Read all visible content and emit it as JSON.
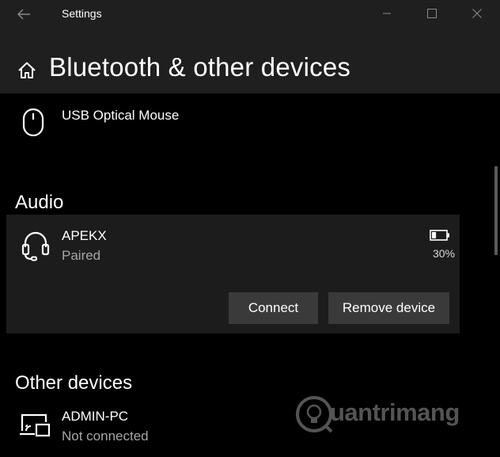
{
  "window": {
    "title": "Settings"
  },
  "header": {
    "page_title": "Bluetooth & other devices"
  },
  "devices": {
    "mouse": {
      "name": "USB Optical Mouse",
      "icon": "mouse-icon"
    }
  },
  "audio": {
    "heading": "Audio",
    "device": {
      "name": "APEKX",
      "status": "Paired",
      "battery": "30%",
      "battery_level": 0.3,
      "icon": "headset-icon"
    },
    "connect_label": "Connect",
    "remove_label": "Remove device"
  },
  "other": {
    "heading": "Other devices",
    "device": {
      "name": "ADMIN-PC",
      "status": "Not connected",
      "icon": "wireless-display-icon"
    }
  },
  "watermark": {
    "text": "uantrimang"
  },
  "colors": {
    "background": "#000000",
    "chrome": "#1f1f1f",
    "card": "#1c1c1c",
    "button": "#3a3a3a",
    "secondary_text": "#a6a6a6"
  }
}
